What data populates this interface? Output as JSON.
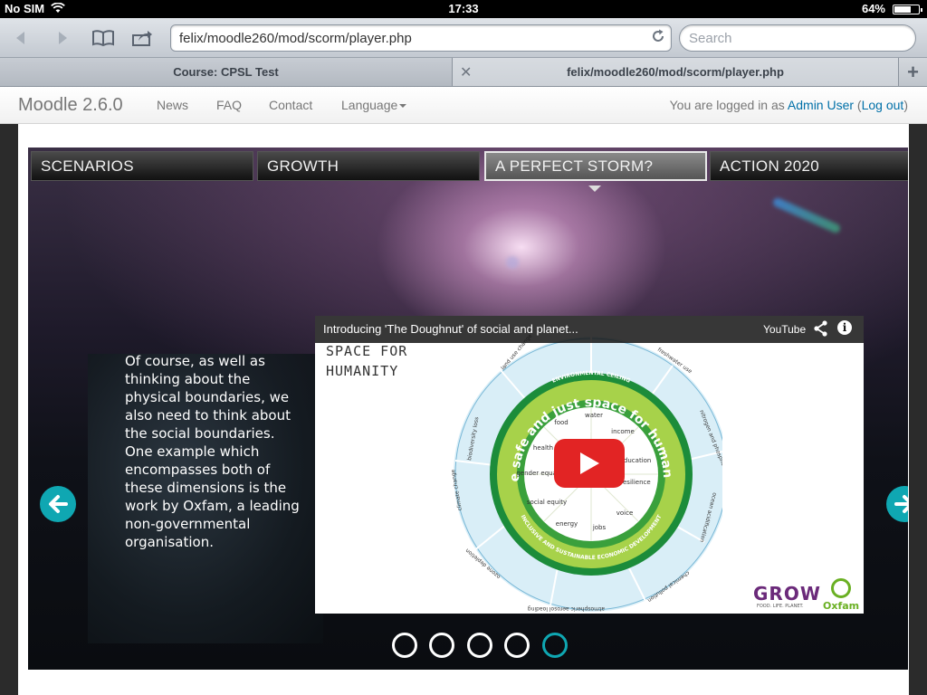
{
  "status_bar": {
    "carrier": "No SIM",
    "time": "17:33",
    "battery": "64%"
  },
  "browser": {
    "url": "felix/moodle260/mod/scorm/player.php",
    "search_placeholder": "Search",
    "tabs": [
      {
        "title": "Course: CPSL Test"
      },
      {
        "title": "felix/moodle260/mod/scorm/player.php"
      }
    ]
  },
  "navbar": {
    "brand": "Moodle 2.6.0",
    "links": [
      "News",
      "FAQ",
      "Contact",
      "Language"
    ],
    "login_prefix": "You are logged in as",
    "user": "Admin User",
    "logout": "Log out"
  },
  "scorm": {
    "menu": [
      "SCENARIOS",
      "GROWTH",
      "A PERFECT STORM?",
      "ACTION 2020"
    ],
    "active_menu": "A PERFECT STORM?",
    "body_text": "Of course, as well as thinking about the physical boundaries, we also need to think about the social boundaries. One example which encompasses both of these dimensions is the work by Oxfam, a leading non-governmental organisation.",
    "video": {
      "title": "Introducing 'The Doughnut' of social and planet...",
      "provider": "YouTube",
      "diagram_heading_1": "SPACE FOR",
      "diagram_heading_2": "HUMANITY",
      "inner_ring": "the safe and just space for humanity",
      "social_foundation": "SOCIAL FOUNDATION",
      "environmental_ceiling": "ENVIRONMENTAL CEILING",
      "lower_ring": "INCLUSIVE AND SUSTAINABLE ECONOMIC DEVELOPMENT",
      "social_items": [
        "food",
        "water",
        "income",
        "education",
        "resilience",
        "voice",
        "jobs",
        "energy",
        "social equity",
        "gender equality",
        "health"
      ],
      "outer_items": [
        "land use change",
        "freshwater use",
        "nitrogen and phosphorus cycles",
        "ocean acidification",
        "chemical pollution",
        "atmospheric aerosol loading",
        "ozone depletion",
        "climate change",
        "biodiversity loss"
      ],
      "logo_grow": "GROW",
      "logo_grow_tag": "FOOD. LIFE. PLANET.",
      "logo_oxfam": "Oxfam"
    },
    "pager": {
      "total": 5,
      "active_index": 5
    }
  }
}
